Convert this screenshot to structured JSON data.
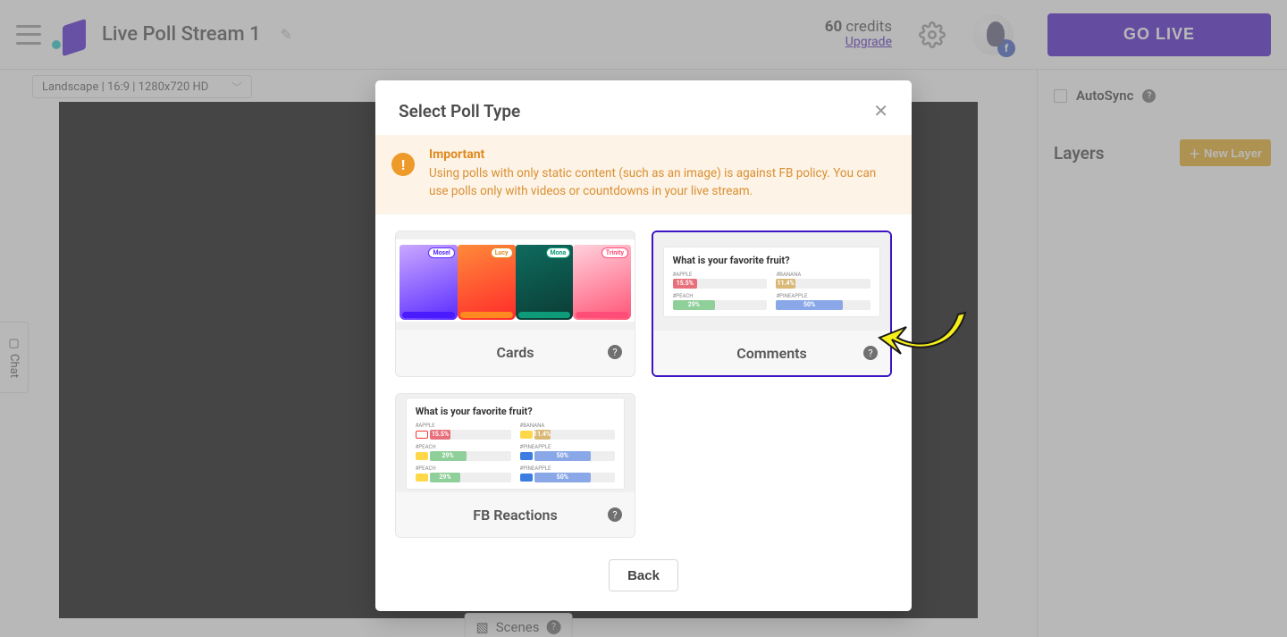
{
  "header": {
    "stream_title": "Live Poll Stream 1",
    "credits_count": "60",
    "credits_label": "credits",
    "upgrade": "Upgrade",
    "go_live": "GO LIVE",
    "avatar_badge": "f"
  },
  "canvas": {
    "resolution": "Landscape | 16:9 | 1280x720 HD",
    "scenes_label": "Scenes"
  },
  "right": {
    "autosync": "AutoSync",
    "layers": "Layers",
    "new_layer": "New Layer"
  },
  "side": {
    "chat": "Chat"
  },
  "modal": {
    "title": "Select Poll Type",
    "alert_title": "Important",
    "alert_body": "Using polls with only static content (such as an image) is against FB policy. You can use polls only with videos or countdowns in your live stream.",
    "options": {
      "cards": "Cards",
      "comments": "Comments",
      "fb_reactions": "FB Reactions"
    },
    "preview": {
      "question": "What is your favorite fruit?",
      "labels": {
        "apple": "#APPLE",
        "banana": "#BANANA",
        "peach": "#PEACH",
        "pineapple": "#PINEAPPLE"
      },
      "values": {
        "apple": "15.5%",
        "banana": "11.4%",
        "peach": "29%",
        "pineapple": "50%"
      },
      "card_tags": {
        "a": "Mosel",
        "b": "Lucy",
        "c": "Mona",
        "d": "Trinity"
      }
    },
    "back": "Back"
  }
}
